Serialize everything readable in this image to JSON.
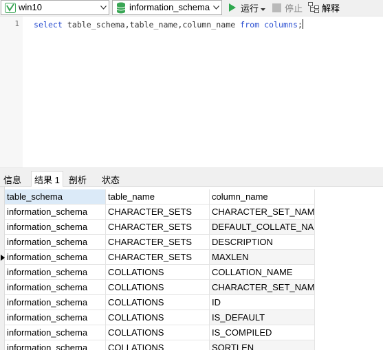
{
  "toolbar": {
    "connection": "win10",
    "database": "information_schema",
    "run_label": "运行",
    "stop_label": "停止",
    "explain_label": "解释"
  },
  "editor": {
    "line_number": "1",
    "tokens": [
      {
        "text": "select",
        "keyword": true
      },
      {
        "text": " table_schema,table_name,column_name ",
        "keyword": false
      },
      {
        "text": "from",
        "keyword": true
      },
      {
        "text": " ",
        "keyword": false
      },
      {
        "text": "columns",
        "keyword": true
      },
      {
        "text": ";",
        "keyword": false
      }
    ]
  },
  "tabs": [
    {
      "label": "信息",
      "active": false
    },
    {
      "label": "结果 1",
      "active": true
    },
    {
      "label": "剖析",
      "active": false
    },
    {
      "label": "状态",
      "active": false
    }
  ],
  "grid": {
    "columns": [
      "table_schema",
      "table_name",
      "column_name"
    ],
    "current_row": 3,
    "rows": [
      [
        "information_schema",
        "CHARACTER_SETS",
        "CHARACTER_SET_NAME"
      ],
      [
        "information_schema",
        "CHARACTER_SETS",
        "DEFAULT_COLLATE_NAME"
      ],
      [
        "information_schema",
        "CHARACTER_SETS",
        "DESCRIPTION"
      ],
      [
        "information_schema",
        "CHARACTER_SETS",
        "MAXLEN"
      ],
      [
        "information_schema",
        "COLLATIONS",
        "COLLATION_NAME"
      ],
      [
        "information_schema",
        "COLLATIONS",
        "CHARACTER_SET_NAME"
      ],
      [
        "information_schema",
        "COLLATIONS",
        "ID"
      ],
      [
        "information_schema",
        "COLLATIONS",
        "IS_DEFAULT"
      ],
      [
        "information_schema",
        "COLLATIONS",
        "IS_COMPILED"
      ],
      [
        "information_schema",
        "COLLATIONS",
        "SORTLEN"
      ]
    ]
  },
  "colors": {
    "keyword": "#2b4fd1",
    "run_green": "#2fa84f",
    "db_green": "#3aa655",
    "selected_header": "#dbeaf8"
  }
}
